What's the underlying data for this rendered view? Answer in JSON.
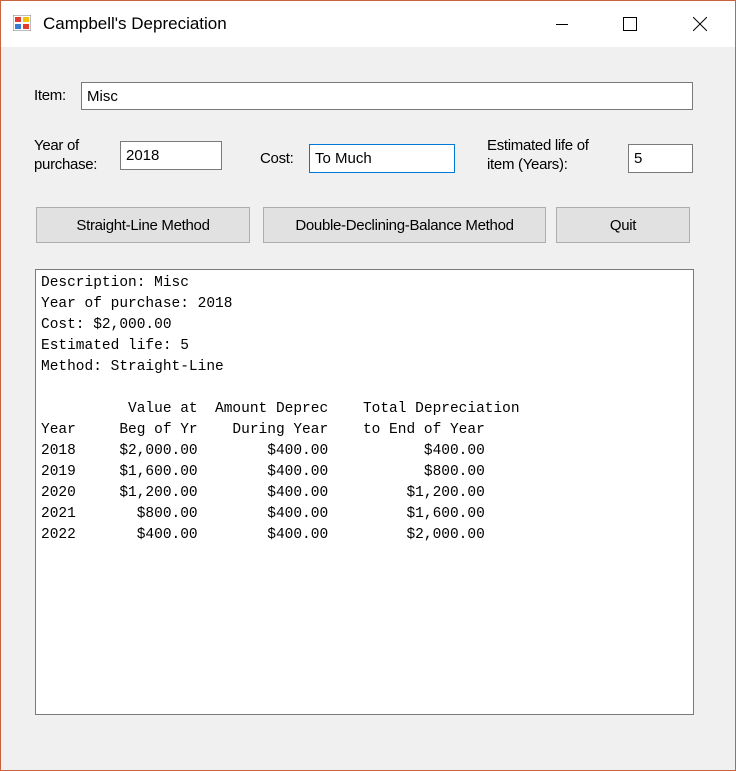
{
  "window": {
    "title": "Campbell's Depreciation"
  },
  "form": {
    "item_label": "Item:",
    "item_value": "Misc",
    "year_label_line1": "Year of",
    "year_label_line2": "purchase:",
    "year_value": "2018",
    "cost_label": "Cost:",
    "cost_value": "To Much",
    "life_label_line1": "Estimated life of",
    "life_label_line2": "item (Years):",
    "life_value": "5"
  },
  "buttons": {
    "straight_line": "Straight-Line Method",
    "double_declining": "Double-Declining-Balance Method",
    "quit": "Quit"
  },
  "output": {
    "lines": [
      "Description: Misc",
      "Year of purchase: 2018",
      "Cost: $2,000.00",
      "Estimated life: 5",
      "Method: Straight-Line",
      "",
      "          Value at  Amount Deprec    Total Depreciation",
      "Year     Beg of Yr    During Year    to End of Year",
      "2018     $2,000.00        $400.00           $400.00",
      "2019     $1,600.00        $400.00           $800.00",
      "2020     $1,200.00        $400.00         $1,200.00",
      "2021       $800.00        $400.00         $1,600.00",
      "2022       $400.00        $400.00         $2,000.00"
    ]
  }
}
